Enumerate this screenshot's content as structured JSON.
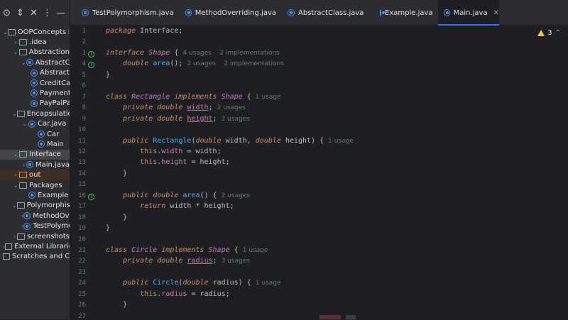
{
  "toolbar": {
    "icons": [
      "target-icon",
      "expand-collapse-icon",
      "close-icon",
      "more-icon",
      "minimize-icon"
    ]
  },
  "project_tree": [
    {
      "level": 0,
      "kind": "folder",
      "expanded": true,
      "label": "OOPConcepts",
      "hint": "sc"
    },
    {
      "level": 1,
      "kind": "folder",
      "expanded": false,
      "label": ".idea"
    },
    {
      "level": 1,
      "kind": "folder",
      "expanded": true,
      "label": "Abstraction"
    },
    {
      "level": 2,
      "kind": "class",
      "expanded": true,
      "label": "AbstractCla"
    },
    {
      "level": 3,
      "kind": "class",
      "label": "Abstract"
    },
    {
      "level": 3,
      "kind": "class",
      "label": "CreditCa"
    },
    {
      "level": 3,
      "kind": "class",
      "label": "Payment"
    },
    {
      "level": 3,
      "kind": "class",
      "label": "PayPalPa"
    },
    {
      "level": 1,
      "kind": "folder",
      "expanded": true,
      "label": "Encapsulation"
    },
    {
      "level": 2,
      "kind": "class",
      "expanded": true,
      "label": "Car.java"
    },
    {
      "level": 3,
      "kind": "class",
      "label": "Car"
    },
    {
      "level": 3,
      "kind": "class",
      "label": "Main"
    },
    {
      "level": 1,
      "kind": "folder",
      "expanded": true,
      "label": "Interface",
      "selected": true
    },
    {
      "level": 2,
      "kind": "class",
      "expanded": false,
      "label": "Main.java"
    },
    {
      "level": 1,
      "kind": "folder-orange",
      "expanded": false,
      "label": "out",
      "selected2": true
    },
    {
      "level": 1,
      "kind": "folder",
      "expanded": true,
      "label": "Packages"
    },
    {
      "level": 2,
      "kind": "class",
      "label": "Example"
    },
    {
      "level": 1,
      "kind": "folder",
      "expanded": true,
      "label": "Polymorphism"
    },
    {
      "level": 2,
      "kind": "class",
      "expanded": false,
      "label": "MethodOve"
    },
    {
      "level": 2,
      "kind": "class",
      "expanded": false,
      "label": "TestPolymo"
    },
    {
      "level": 1,
      "kind": "folder",
      "expanded": false,
      "label": "screenshots"
    },
    {
      "level": 0,
      "kind": "lib",
      "expanded": false,
      "label": "External Libraries"
    },
    {
      "level": 0,
      "kind": "lib",
      "label": "Scratches and Co"
    }
  ],
  "tabs": [
    {
      "label": "TestPolymorphism.java",
      "active": false
    },
    {
      "label": "MethodOverriding.java",
      "active": false
    },
    {
      "label": "AbstractClass.java",
      "active": false
    },
    {
      "label": "Example.java",
      "active": false
    },
    {
      "label": "Main.java",
      "active": true,
      "close": "✕"
    }
  ],
  "inspections": {
    "warning_count": "3"
  },
  "editor": {
    "lines": [
      {
        "n": "1",
        "gutter": "",
        "tokens": [
          [
            "kw",
            "package "
          ],
          [
            "",
            "Interface;"
          ]
        ]
      },
      {
        "n": "2",
        "gutter": "",
        "tokens": []
      },
      {
        "n": "3",
        "gutter": "impl",
        "tokens": [
          [
            "kw",
            "interface "
          ],
          [
            "ty",
            "Shape "
          ],
          [
            "",
            "{ "
          ],
          [
            "usage",
            "4 usages    2 implementations"
          ]
        ]
      },
      {
        "n": "4",
        "gutter": "impl",
        "tokens": [
          [
            "",
            "    "
          ],
          [
            "kw",
            "double "
          ],
          [
            "fn",
            "area"
          ],
          [
            "",
            "(); "
          ],
          [
            "usage",
            "2 usages    2 implementations"
          ]
        ]
      },
      {
        "n": "5",
        "gutter": "",
        "tokens": [
          [
            "",
            "}"
          ]
        ]
      },
      {
        "n": "6",
        "gutter": "",
        "tokens": []
      },
      {
        "n": "7",
        "gutter": "",
        "tokens": [
          [
            "kw",
            "class "
          ],
          [
            "ty",
            "Rectangle "
          ],
          [
            "kw",
            "implements "
          ],
          [
            "ty",
            "Shape "
          ],
          [
            "",
            "{ "
          ],
          [
            "usage",
            "1 usage"
          ]
        ]
      },
      {
        "n": "8",
        "gutter": "",
        "tokens": [
          [
            "",
            "    "
          ],
          [
            "kw",
            "private double "
          ],
          [
            "fld ul",
            "width"
          ],
          [
            "",
            "; "
          ],
          [
            "usage",
            "2 usages"
          ]
        ]
      },
      {
        "n": "9",
        "gutter": "",
        "tokens": [
          [
            "",
            "    "
          ],
          [
            "kw",
            "private double "
          ],
          [
            "fld ul",
            "height"
          ],
          [
            "",
            "; "
          ],
          [
            "usage",
            "2 usages"
          ]
        ]
      },
      {
        "n": "10",
        "gutter": "",
        "tokens": []
      },
      {
        "n": "11",
        "gutter": "",
        "tokens": [
          [
            "",
            "    "
          ],
          [
            "kw",
            "public "
          ],
          [
            "fn",
            "Rectangle"
          ],
          [
            "",
            "("
          ],
          [
            "kw",
            "double "
          ],
          [
            "",
            "width, "
          ],
          [
            "kw",
            "double "
          ],
          [
            "",
            "height) { "
          ],
          [
            "usage",
            "1 usage"
          ]
        ]
      },
      {
        "n": "12",
        "gutter": "",
        "tokens": [
          [
            "",
            "        "
          ],
          [
            "kwn",
            "this"
          ],
          [
            "",
            "."
          ],
          [
            "fld",
            "width"
          ],
          [
            "",
            " = width;"
          ]
        ]
      },
      {
        "n": "13",
        "gutter": "",
        "tokens": [
          [
            "",
            "        "
          ],
          [
            "kwn",
            "this"
          ],
          [
            "",
            "."
          ],
          [
            "fld",
            "height"
          ],
          [
            "",
            " = height;"
          ]
        ]
      },
      {
        "n": "14",
        "gutter": "",
        "tokens": [
          [
            "",
            "    }"
          ]
        ]
      },
      {
        "n": "15",
        "gutter": "",
        "tokens": []
      },
      {
        "n": "16",
        "gutter": "override",
        "tokens": [
          [
            "",
            "    "
          ],
          [
            "kw",
            "public double "
          ],
          [
            "fn",
            "area"
          ],
          [
            "",
            "() { "
          ],
          [
            "usage",
            "2 usages"
          ]
        ]
      },
      {
        "n": "17",
        "gutter": "",
        "tokens": [
          [
            "",
            "        "
          ],
          [
            "kw",
            "return "
          ],
          [
            "",
            "width * height;"
          ]
        ]
      },
      {
        "n": "18",
        "gutter": "",
        "tokens": [
          [
            "",
            "    }"
          ]
        ]
      },
      {
        "n": "19",
        "gutter": "",
        "tokens": [
          [
            "",
            "}"
          ]
        ]
      },
      {
        "n": "20",
        "gutter": "",
        "tokens": []
      },
      {
        "n": "21",
        "gutter": "",
        "tokens": [
          [
            "kw",
            "class "
          ],
          [
            "ty",
            "Circle "
          ],
          [
            "kw",
            "implements "
          ],
          [
            "ty",
            "Shape "
          ],
          [
            "",
            "{ "
          ],
          [
            "usage",
            "1 usage"
          ]
        ]
      },
      {
        "n": "22",
        "gutter": "",
        "tokens": [
          [
            "",
            "    "
          ],
          [
            "kw",
            "private double "
          ],
          [
            "fld ul",
            "radius"
          ],
          [
            "",
            "; "
          ],
          [
            "usage",
            "3 usages"
          ]
        ]
      },
      {
        "n": "23",
        "gutter": "",
        "tokens": []
      },
      {
        "n": "24",
        "gutter": "",
        "tokens": [
          [
            "",
            "    "
          ],
          [
            "kw",
            "public "
          ],
          [
            "fn",
            "Circle"
          ],
          [
            "",
            "("
          ],
          [
            "kw",
            "double "
          ],
          [
            "",
            "radius) { "
          ],
          [
            "usage",
            "1 usage"
          ]
        ]
      },
      {
        "n": "25",
        "gutter": "",
        "tokens": [
          [
            "",
            "        "
          ],
          [
            "kwn",
            "this"
          ],
          [
            "",
            "."
          ],
          [
            "fld",
            "radius"
          ],
          [
            "",
            " = radius;"
          ]
        ]
      },
      {
        "n": "26",
        "gutter": "",
        "tokens": [
          [
            "",
            "    }"
          ]
        ]
      },
      {
        "n": "27",
        "gutter": "",
        "tokens": []
      }
    ]
  }
}
